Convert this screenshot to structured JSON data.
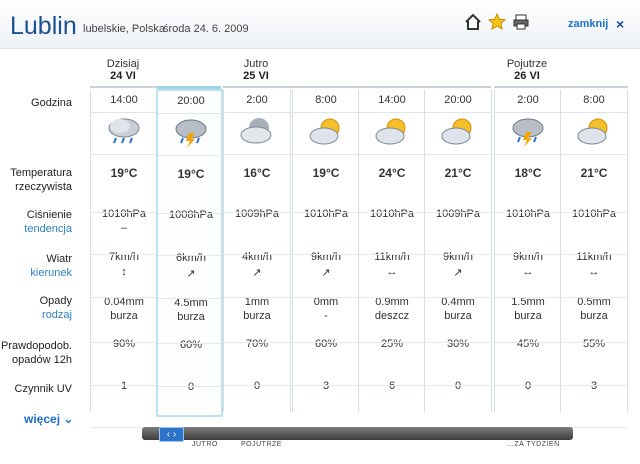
{
  "header": {
    "city": "Lublin",
    "region": "lubelskie, Polska",
    "date": "środa 24. 6. 2009",
    "close_label": "zamknij",
    "close_icon": "×",
    "icons": [
      "home-icon",
      "star-icon",
      "printer-icon"
    ]
  },
  "days": [
    {
      "name": "Dzisiaj",
      "date": "24 VI"
    },
    {
      "name": "Jutro",
      "date": "25 VI"
    },
    {
      "name": "Pojutrze",
      "date": "26 VI"
    }
  ],
  "row_labels": {
    "time": "Godzina",
    "temp_1": "Temperatura",
    "temp_2": "rzeczywista",
    "pressure": "Ciśnienie",
    "pressure_sub": "tendencja",
    "wind": "Wiatr",
    "wind_sub": "kierunek",
    "precip": "Opady",
    "precip_sub": "rodzaj",
    "prob_1": "Prawdopodob.",
    "prob_2": "opadów 12h",
    "uv": "Czynnik UV"
  },
  "columns": [
    {
      "time": "14:00",
      "icon": "cloud-rain-icon",
      "temp": "19°C",
      "pressure": "1010hPa",
      "tendency": "–",
      "wind": "7km/h",
      "dir": "↕",
      "precip": "0.04mm",
      "type": "burza",
      "prob": "90%",
      "uv": "1"
    },
    {
      "time": "20:00",
      "icon": "thunderstorm-icon",
      "temp": "19°C",
      "pressure": "1008hPa",
      "tendency": "",
      "wind": "6km/h",
      "dir": "↗",
      "precip": "4.5mm",
      "type": "burza",
      "prob": "60%",
      "uv": "0"
    },
    {
      "time": "2:00",
      "icon": "cloud-moon-icon",
      "temp": "16°C",
      "pressure": "1009hPa",
      "tendency": "",
      "wind": "4km/h",
      "dir": "↗",
      "precip": "1mm",
      "type": "burza",
      "prob": "70%",
      "uv": "0"
    },
    {
      "time": "8:00",
      "icon": "partly-sunny-icon",
      "temp": "19°C",
      "pressure": "1010hPa",
      "tendency": "",
      "wind": "9km/h",
      "dir": "↗",
      "precip": "0mm",
      "type": "-",
      "prob": "60%",
      "uv": "3"
    },
    {
      "time": "14:00",
      "icon": "partly-sunny-icon",
      "temp": "24°C",
      "pressure": "1010hPa",
      "tendency": "",
      "wind": "11km/h",
      "dir": "↔",
      "precip": "0.9mm",
      "type": "deszcz",
      "prob": "25%",
      "uv": "6"
    },
    {
      "time": "20:00",
      "icon": "partly-sunny-icon",
      "temp": "21°C",
      "pressure": "1009hPa",
      "tendency": "",
      "wind": "9km/h",
      "dir": "↗",
      "precip": "0.4mm",
      "type": "burza",
      "prob": "30%",
      "uv": "0"
    },
    {
      "time": "2:00",
      "icon": "thunderstorm-icon",
      "temp": "18°C",
      "pressure": "1010hPa",
      "tendency": "",
      "wind": "9km/h",
      "dir": "↔",
      "precip": "1.5mm",
      "type": "burza",
      "prob": "45%",
      "uv": "0"
    },
    {
      "time": "8:00",
      "icon": "partly-sunny-icon",
      "temp": "21°C",
      "pressure": "1010hPa",
      "tendency": "",
      "wind": "11km/h",
      "dir": "↔",
      "precip": "0.5mm",
      "type": "burza",
      "prob": "55%",
      "uv": "3"
    }
  ],
  "footer": {
    "more": "więcej",
    "more_icon": "⌄",
    "slider_icon": "‹ ›",
    "ticks": [
      "JUTRO",
      "POJUTRZE",
      "...ZA TYDZIEŃ"
    ]
  }
}
